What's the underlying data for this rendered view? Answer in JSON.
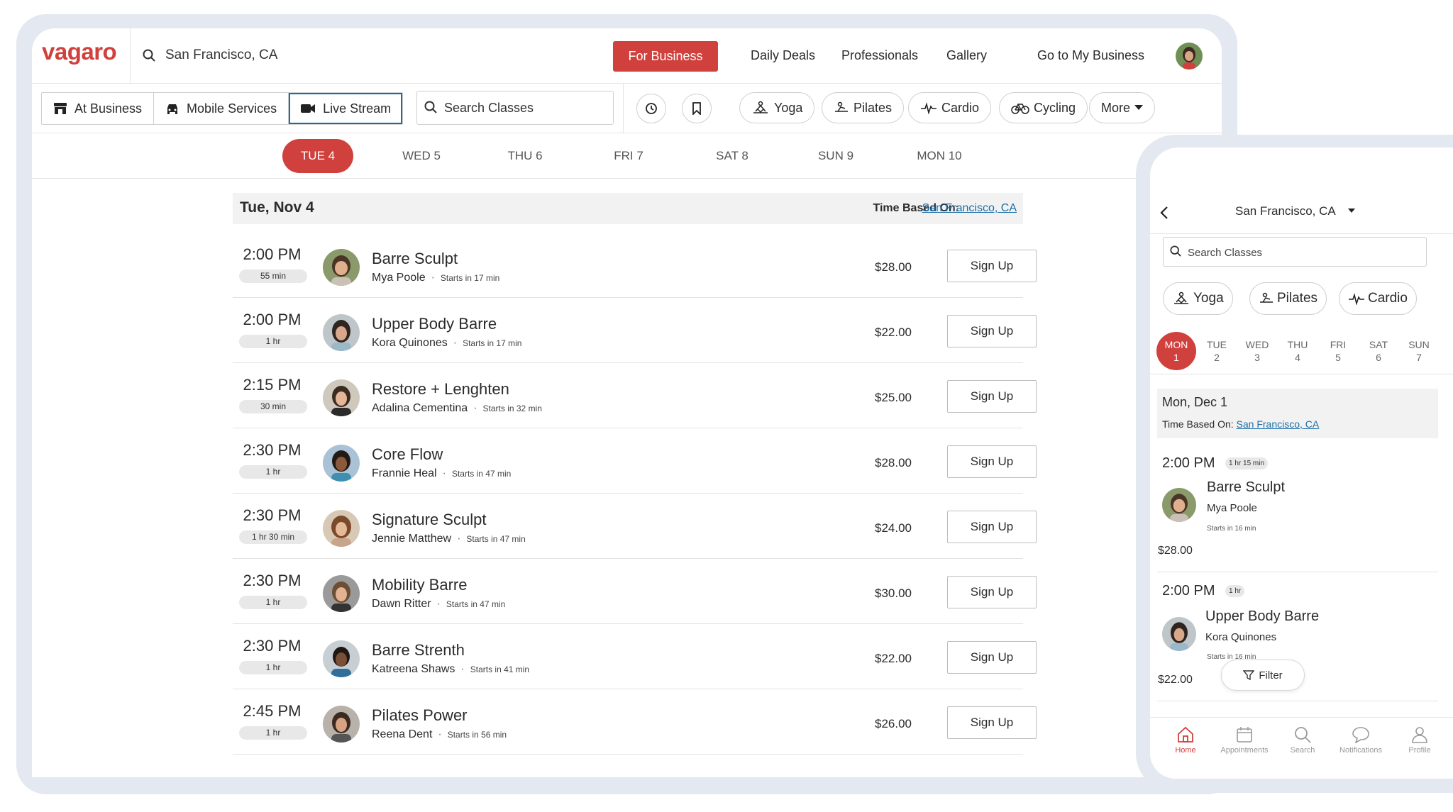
{
  "colors": {
    "brand": "#d0403c",
    "link": "#1b6fa8",
    "frame": "#e3e8f1"
  },
  "desktop": {
    "logo": "vagaro",
    "location": "San Francisco, CA",
    "nav": {
      "for_business": "For Business",
      "daily_deals": "Daily Deals",
      "professionals": "Professionals",
      "gallery": "Gallery",
      "go_to_business": "Go to My Business"
    },
    "modes": [
      {
        "label": "At Business",
        "icon": "storefront-icon"
      },
      {
        "label": "Mobile Services",
        "icon": "car-icon"
      },
      {
        "label": "Live Stream",
        "icon": "video-camera-icon",
        "active": true
      }
    ],
    "search_placeholder": "Search Classes",
    "categories": [
      {
        "label": "Yoga",
        "icon": "yoga-icon"
      },
      {
        "label": "Pilates",
        "icon": "pilates-icon"
      },
      {
        "label": "Cardio",
        "icon": "heartbeat-icon"
      },
      {
        "label": "Cycling",
        "icon": "bicycle-icon"
      },
      {
        "label": "More",
        "icon": "caret-down-icon"
      }
    ],
    "dates": [
      "TUE 4",
      "WED 5",
      "THU 6",
      "FRI 7",
      "SAT 8",
      "SUN 9",
      "MON 10"
    ],
    "active_date": "TUE 4",
    "day_title": "Tue, Nov 4",
    "time_based_label": "Time Based On:",
    "time_based_link": "San Francisco, CA",
    "classes": [
      {
        "time": "2:00 PM",
        "duration": "55 min",
        "name": "Barre Sculpt",
        "instructor": "Mya Poole",
        "starts": "Starts in 17 min",
        "price": "$28.00",
        "button": "Sign Up"
      },
      {
        "time": "2:00 PM",
        "duration": "1 hr",
        "name": "Upper Body Barre",
        "instructor": "Kora Quinones",
        "starts": "Starts in 17 min",
        "price": "$22.00",
        "button": "Sign Up"
      },
      {
        "time": "2:15 PM",
        "duration": "30 min",
        "name": "Restore + Lenghten",
        "instructor": "Adalina Cementina",
        "starts": "Starts in 32 min",
        "price": "$25.00",
        "button": "Sign Up"
      },
      {
        "time": "2:30 PM",
        "duration": "1 hr",
        "name": "Core Flow",
        "instructor": "Frannie Heal",
        "starts": "Starts in 47 min",
        "price": "$28.00",
        "button": "Sign Up"
      },
      {
        "time": "2:30 PM",
        "duration": "1 hr 30 min",
        "name": "Signature Sculpt",
        "instructor": "Jennie Matthew",
        "starts": "Starts in 47 min",
        "price": "$24.00",
        "button": "Sign Up"
      },
      {
        "time": "2:30 PM",
        "duration": "1 hr",
        "name": "Mobility Barre",
        "instructor": "Dawn Ritter",
        "starts": "Starts in 47 min",
        "price": "$30.00",
        "button": "Sign Up"
      },
      {
        "time": "2:30 PM",
        "duration": "1 hr",
        "name": "Barre Strenth",
        "instructor": "Katreena Shaws",
        "starts": "Starts in 41 min",
        "price": "$22.00",
        "button": "Sign Up"
      },
      {
        "time": "2:45 PM",
        "duration": "1 hr",
        "name": "Pilates Power",
        "instructor": "Reena Dent",
        "starts": "Starts in 56 min",
        "price": "$26.00",
        "button": "Sign Up"
      }
    ]
  },
  "mobile": {
    "location": "San Francisco, CA",
    "search_placeholder": "Search Classes",
    "categories": [
      "Yoga",
      "Pilates",
      "Cardio"
    ],
    "days": [
      {
        "dow": "MON",
        "num": "1",
        "active": true
      },
      {
        "dow": "TUE",
        "num": "2"
      },
      {
        "dow": "WED",
        "num": "3"
      },
      {
        "dow": "THU",
        "num": "4"
      },
      {
        "dow": "FRI",
        "num": "5"
      },
      {
        "dow": "SAT",
        "num": "6"
      },
      {
        "dow": "SUN",
        "num": "7"
      }
    ],
    "day_title": "Mon, Dec 1",
    "time_based_label": "Time Based On:",
    "time_based_link": "San Francisco, CA",
    "classes": [
      {
        "time": "2:00 PM",
        "duration": "1 hr 15 min",
        "name": "Barre Sculpt",
        "instructor": "Mya Poole",
        "starts": "Starts in 16 min",
        "price": "$28.00"
      },
      {
        "time": "2:00 PM",
        "duration": "1 hr",
        "name": "Upper Body Barre",
        "instructor": "Kora Quinones",
        "starts": "Starts in 16 min",
        "price": "$22.00"
      }
    ],
    "filter_label": "Filter",
    "tabs": [
      {
        "label": "Home",
        "icon": "home-icon",
        "active": true
      },
      {
        "label": "Appointments",
        "icon": "calendar-icon"
      },
      {
        "label": "Search",
        "icon": "search-icon"
      },
      {
        "label": "Notifications",
        "icon": "chat-bubble-icon"
      },
      {
        "label": "Profile",
        "icon": "person-icon"
      }
    ]
  }
}
